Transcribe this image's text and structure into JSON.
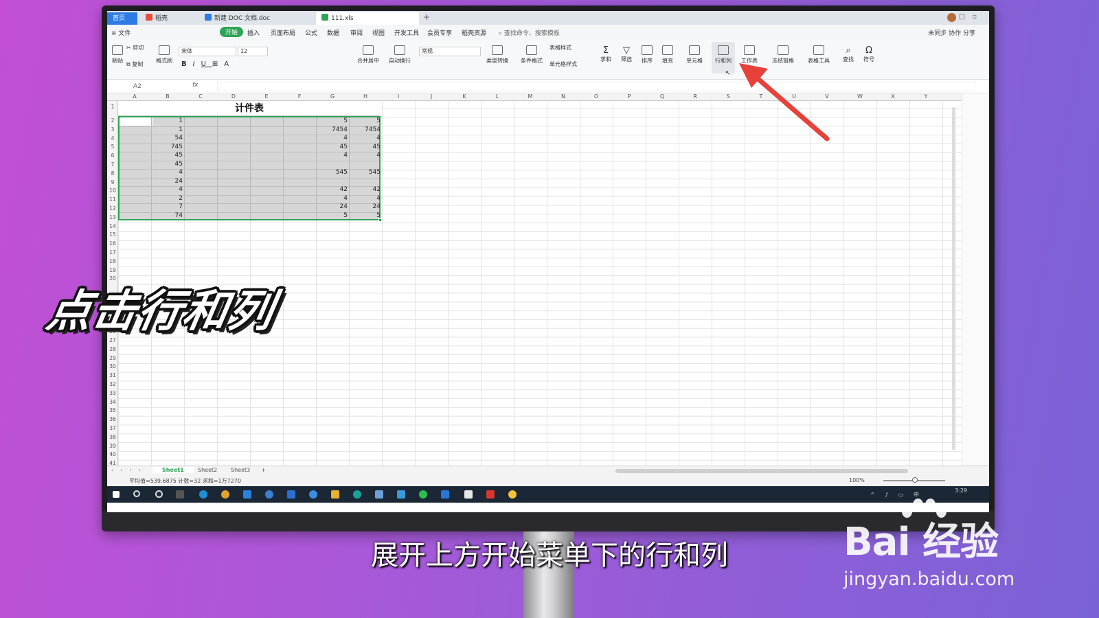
{
  "window": {
    "tabs": [
      {
        "label": "首页"
      },
      {
        "label": "稻壳"
      },
      {
        "label": "新建 DOC 文档.doc"
      },
      {
        "label": "111.xls"
      }
    ]
  },
  "menu": {
    "file": "≡ 文件",
    "items": [
      "开始",
      "插入",
      "页面布局",
      "公式",
      "数据",
      "审阅",
      "视图",
      "开发工具",
      "会员专享",
      "稻壳资源"
    ],
    "search": "查找命令、搜索模板",
    "right": "未同步  协作  分享"
  },
  "ribbon": {
    "cut": "剪切",
    "paste": "粘贴",
    "copy": "复制",
    "format_painter": "格式刷",
    "font": "宋体",
    "size": "12",
    "merge": "合并居中",
    "wrap": "自动换行",
    "number_format": "常规",
    "type_convert": "类型转换",
    "cond_format": "条件格式",
    "table_style": "表格样式",
    "cell_style": "单元格样式",
    "sum": "求和",
    "filter": "筛选",
    "sort": "排序",
    "fill": "填充",
    "cell": "单元格",
    "row_col": "行和列",
    "worksheet": "工作表",
    "freeze": "冻结窗格",
    "table_tools": "表格工具",
    "find": "查找",
    "symbol": "符号"
  },
  "formula_bar": {
    "name_box": "A2",
    "fx": "fx"
  },
  "columns": [
    "A",
    "B",
    "C",
    "D",
    "E",
    "F",
    "G",
    "H",
    "I",
    "J",
    "K",
    "L",
    "M",
    "N",
    "O",
    "P",
    "Q",
    "R",
    "S",
    "T",
    "U",
    "V",
    "W",
    "X",
    "Y"
  ],
  "rows": [
    "1",
    "2",
    "3",
    "4",
    "5",
    "6",
    "7",
    "8",
    "9",
    "10",
    "11",
    "12",
    "13",
    "14",
    "15",
    "16",
    "17",
    "18",
    "19",
    "20",
    "",
    "",
    "",
    "",
    "",
    "26",
    "27",
    "28",
    "29",
    "30",
    "31",
    "32",
    "33",
    "34",
    "35",
    "36",
    "37",
    "38",
    "39",
    "40",
    "41"
  ],
  "sheet": {
    "title": "计件表",
    "col_b": [
      "1",
      "1",
      "54",
      "745",
      "45",
      "45",
      "4",
      "24",
      "4",
      "2",
      "7",
      "74"
    ],
    "col_g": [
      "5",
      "7454",
      "4",
      "45",
      "4",
      "",
      "545",
      "",
      "42",
      "4",
      "24",
      "5"
    ],
    "col_h": [
      "5",
      "7454",
      "4",
      "45",
      "4",
      "",
      "545",
      "",
      "42",
      "4",
      "24",
      "5"
    ]
  },
  "sheet_tabs": [
    "Sheet1",
    "Sheet2",
    "Sheet3"
  ],
  "status": {
    "summary": "平均值=539.6875  计数=32  求和=1万7270",
    "zoom": "100%"
  },
  "taskbar": {
    "time": "3:29",
    "ime": "中"
  },
  "overlay": {
    "big_caption": "点击行和列",
    "subtitle": "展开上方开始菜单下的行和列",
    "watermark_logo": "Bai 经验",
    "watermark_url": "jingyan.baidu.com"
  },
  "colors": {
    "accent": "#2ea456",
    "tab_blue": "#2d7be5",
    "arrow": "#e8403a"
  }
}
